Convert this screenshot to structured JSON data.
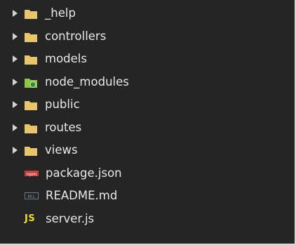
{
  "explorer": {
    "items": [
      {
        "label": "_help",
        "kind": "folder",
        "icon": "folder-icon"
      },
      {
        "label": "controllers",
        "kind": "folder",
        "icon": "folder-icon"
      },
      {
        "label": "models",
        "kind": "folder",
        "icon": "folder-icon"
      },
      {
        "label": "node_modules",
        "kind": "folder",
        "icon": "node-folder-icon"
      },
      {
        "label": "public",
        "kind": "folder",
        "icon": "folder-icon"
      },
      {
        "label": "routes",
        "kind": "folder",
        "icon": "folder-icon"
      },
      {
        "label": "views",
        "kind": "folder",
        "icon": "folder-icon"
      },
      {
        "label": "package.json",
        "kind": "file",
        "icon": "npm-icon",
        "badge": "npm"
      },
      {
        "label": "README.md",
        "kind": "file",
        "icon": "markdown-icon",
        "badge": "M↓"
      },
      {
        "label": "server.js",
        "kind": "file",
        "icon": "javascript-icon",
        "badge": "JS"
      }
    ]
  },
  "colors": {
    "background": "#252526",
    "text": "#e8e8e8",
    "folder": "#e8c46b",
    "node_folder": "#8cc84b",
    "npm": "#cb3837",
    "markdown": "#6b7a86",
    "javascript": "#f1dd3f",
    "border": "#d9d9d9"
  }
}
